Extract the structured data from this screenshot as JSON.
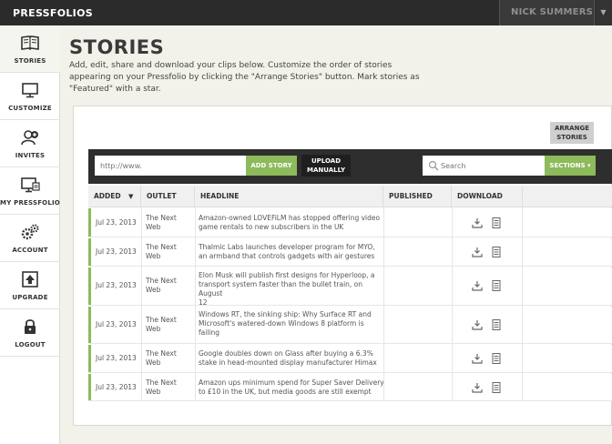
{
  "brand": "PRESSFOLIOS",
  "user": {
    "name": "NICK SUMMERS"
  },
  "sidebar": {
    "items": [
      {
        "label": "STORIES",
        "icon": "book-icon"
      },
      {
        "label": "CUSTOMIZE",
        "icon": "monitor-icon"
      },
      {
        "label": "INVITES",
        "icon": "add-user-icon"
      },
      {
        "label": "MY PRESSFOLIO",
        "icon": "my-pressfolio-icon"
      },
      {
        "label": "ACCOUNT",
        "icon": "gears-icon"
      },
      {
        "label": "UPGRADE",
        "icon": "upgrade-arrow-icon"
      },
      {
        "label": "LOGOUT",
        "icon": "lock-icon"
      }
    ]
  },
  "header": {
    "title": "STORIES",
    "description": "Add, edit, share and download your clips below. Customize the order of stories appearing on your Pressfolio by clicking the \"Arrange Stories\" button. Mark stories as \"Featured\" with a star."
  },
  "toolbar": {
    "arrange_label_1": "ARRANGE",
    "arrange_label_2": "STORIES",
    "url_placeholder": "http://www.",
    "add_story_label": "ADD STORY",
    "upload_label_1": "UPLOAD",
    "upload_label_2": "MANUALLY",
    "search_placeholder": "Search",
    "sections_label": "SECTIONS ▾"
  },
  "table": {
    "columns": {
      "added": "ADDED",
      "outlet": "OUTLET",
      "headline": "HEADLINE",
      "published": "PUBLISHED",
      "download": "DOWNLOAD"
    },
    "rows": [
      {
        "added": "Jul 23, 2013",
        "outlet_1": "The Next",
        "outlet_2": "Web",
        "headline_1": "Amazon-owned LOVEFiLM has stopped offering video",
        "headline_2": "game rentals to new subscribers in the UK",
        "headline_3": ""
      },
      {
        "added": "Jul 23, 2013",
        "outlet_1": "The Next",
        "outlet_2": "Web",
        "headline_1": "Thalmic Labs launches developer program for MYO,",
        "headline_2": "an armband that controls gadgets with air gestures",
        "headline_3": ""
      },
      {
        "added": "Jul 23, 2013",
        "outlet_1": "The Next",
        "outlet_2": "Web",
        "headline_1": "Elon Musk will publish first designs for Hyperloop, a",
        "headline_2": "transport system faster than the bullet train, on August",
        "headline_3": "12"
      },
      {
        "added": "Jul 23, 2013",
        "outlet_1": "The Next",
        "outlet_2": "Web",
        "headline_1": "Windows RT, the sinking ship: Why Surface RT and",
        "headline_2": "Microsoft's watered-down Windows 8 platform is",
        "headline_3": "failing"
      },
      {
        "added": "Jul 23, 2013",
        "outlet_1": "The Next",
        "outlet_2": "Web",
        "headline_1": "Google doubles down on Glass after buying a 6.3%",
        "headline_2": "stake in head-mounted display manufacturer Himax",
        "headline_3": ""
      },
      {
        "added": "Jul 23, 2013",
        "outlet_1": "The Next",
        "outlet_2": "Web",
        "headline_1": "Amazon ups minimum spend for Super Saver Delivery",
        "headline_2": "to £10 in the UK, but media goods are still exempt",
        "headline_3": ""
      }
    ]
  },
  "colors": {
    "topbar": "#2b2b2b",
    "accent_green": "#8dba5a",
    "toolbar": "#2e2e2e"
  }
}
